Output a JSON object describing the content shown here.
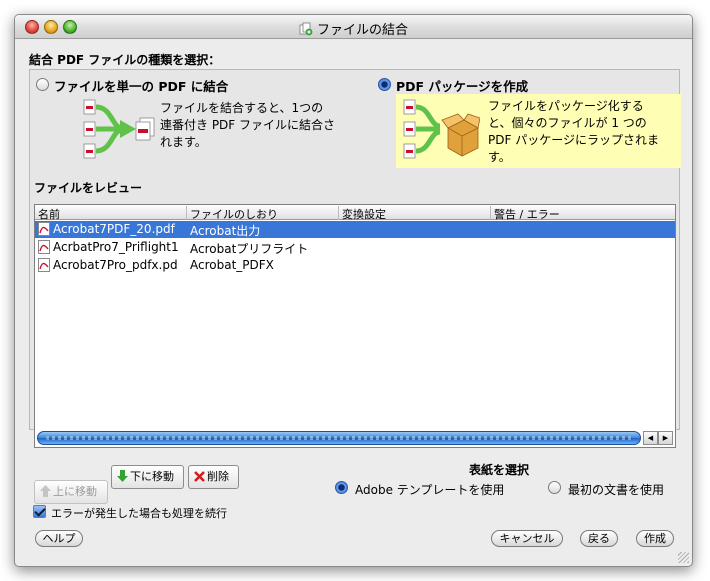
{
  "window": {
    "title": "ファイルの結合"
  },
  "type_group": {
    "label": "結合 PDF ファイルの種類を選択：",
    "single": {
      "label": "ファイルを単一の PDF に結合",
      "selected": false,
      "description": [
        "ファイルを結合すると、1つの",
        "連番付き PDF ファイルに結合さ",
        "れます。"
      ]
    },
    "package": {
      "label": "PDF パッケージを作成",
      "selected": true,
      "description": [
        "ファイルをパッケージ化する",
        "と、個々のファイルが 1 つの",
        "PDF パッケージにラップされま",
        "す。"
      ]
    }
  },
  "review": {
    "label": "ファイルをレビュー",
    "columns": [
      "名前",
      "ファイルのしおり",
      "変換設定",
      "警告 / エラー"
    ],
    "rows": [
      {
        "name": "Acrobat7PDF_20.pdf",
        "bookmark": "Acrobat出力",
        "conversion": "",
        "warning": "",
        "selected": true
      },
      {
        "name": "AcrbatPro7_Priflight1",
        "bookmark": "Acrobatプリフライト",
        "conversion": "",
        "warning": "",
        "selected": false
      },
      {
        "name": "Acrobat7Pro_pdfx.pd",
        "bookmark": "Acrobat_PDFX",
        "conversion": "",
        "warning": "",
        "selected": false
      }
    ]
  },
  "row_buttons": {
    "move_up": "上に移動",
    "move_down": "下に移動",
    "delete": "削除"
  },
  "cover": {
    "title": "表紙を選択",
    "template": {
      "label": "Adobe テンプレートを使用",
      "selected": true
    },
    "first_doc": {
      "label": "最初の文書を使用",
      "selected": false
    }
  },
  "continue_on_error": {
    "label": "エラーが発生した場合も処理を続行",
    "checked": true
  },
  "buttons": {
    "help": "ヘルプ",
    "cancel": "キャンセル",
    "back": "戻る",
    "create": "作成"
  },
  "colors": {
    "selection": "#3876d7",
    "package_panel": "#fefeb4"
  }
}
